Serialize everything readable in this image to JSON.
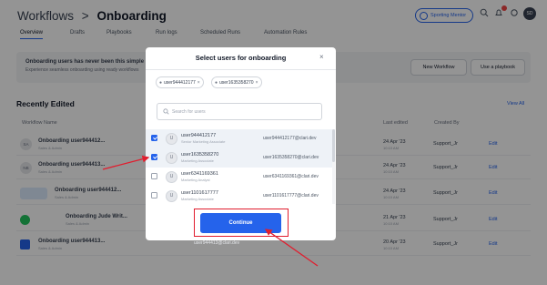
{
  "header": {
    "breadcrumb_parent": "Workflows",
    "breadcrumb_sep": ">",
    "breadcrumb_current": "Onboarding",
    "tabs": [
      "Overview",
      "Drafts",
      "Playbooks",
      "Run logs",
      "Scheduled Runs",
      "Automation Rules"
    ],
    "mentor_label": "Sporting Mentor",
    "avatar_initials": "SD"
  },
  "banner": {
    "title": "Onboarding users has never been this simple",
    "subtitle": "Experience seamless onboarding using ready workflows",
    "new_workflow": "New Workflow",
    "use_playbook": "Use a playbook"
  },
  "recent": {
    "title": "Recently Edited",
    "view_all": "View All",
    "columns": [
      "Workflow Name",
      "Last edited",
      "Created By"
    ],
    "rows": [
      {
        "initials": "SA",
        "name": "Onboarding user944412...",
        "sub": "Sales & Admin",
        "date": "24 Apr '23",
        "date_sub": "10:10 AM",
        "creator": "Support_Jr",
        "action": "Edit"
      },
      {
        "initials": "NB",
        "name": "Onboarding user944413...",
        "sub": "Sales & Admin",
        "date": "24 Apr '23",
        "date_sub": "10:10 AM",
        "creator": "Support_Jr",
        "action": "Edit"
      },
      {
        "initials": "",
        "name": "Onboarding user944412...",
        "sub": "Sales & Admin",
        "date": "24 Apr '23",
        "date_sub": "10:10 AM",
        "creator": "Support_Jr",
        "action": "Edit"
      },
      {
        "initials": "",
        "name": "Onboarding Jude Writ...",
        "sub": "Sales & Admin",
        "date": "21 Apr '23",
        "date_sub": "10:10 AM",
        "creator": "Support_Jr",
        "action": "Edit"
      },
      {
        "initials": "",
        "name": "Onboarding user944413...",
        "sub": "Sales & Admin",
        "date": "20 Apr '23",
        "date_sub": "10:10 AM",
        "creator": "Support_Jr",
        "action": "Edit"
      }
    ]
  },
  "modal": {
    "title": "Select users for onboarding",
    "close": "×",
    "chips": [
      "user944412177",
      "user1635358270"
    ],
    "search_placeholder": "Search for users",
    "users": [
      {
        "initials": "U",
        "name": "user944412177",
        "role": "Senior Marketing Associate",
        "email": "user944412177@clari.dev",
        "checked": true
      },
      {
        "initials": "U",
        "name": "user1635358270",
        "role": "Marketing Associate",
        "email": "user1635358270@clari.dev",
        "checked": true
      },
      {
        "initials": "U",
        "name": "user6341169361",
        "role": "Marketing Analyst",
        "email": "user6341169361@clari.dev",
        "checked": false
      },
      {
        "initials": "U",
        "name": "user1101617777",
        "role": "Marketing Associate",
        "email": "user1101617777@clari.dev",
        "checked": false
      }
    ],
    "continue_label": "Continue",
    "peek_text": "user944413@clari.dev"
  },
  "colors": {
    "accent": "#2563eb",
    "annotation": "#e11d2e",
    "overlay": "rgba(0,0,0,0.42)"
  }
}
